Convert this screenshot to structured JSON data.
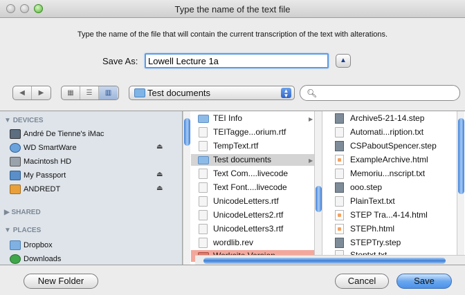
{
  "window": {
    "title": "Type the name of the text file"
  },
  "message": "Type the name of the file that will contain the current transcription of the text with alterations.",
  "save_as": {
    "label": "Save As:",
    "value": "Lowell Lecture 1a"
  },
  "toolbar": {
    "path": "Test documents",
    "search_placeholder": "",
    "nav_back_icon": "back-arrow-icon",
    "nav_forward_icon": "forward-arrow-icon",
    "view_modes": [
      "icon-view",
      "list-view",
      "column-view"
    ],
    "active_view": "column-view"
  },
  "sidebar": {
    "devices_heading": "DEVICES",
    "devices": [
      {
        "label": "André De Tienne's iMac",
        "icon": "imac-icon",
        "eject": false
      },
      {
        "label": "WD SmartWare",
        "icon": "disk-icon",
        "eject": true
      },
      {
        "label": "Macintosh HD",
        "icon": "harddrive-icon",
        "eject": false
      },
      {
        "label": "My Passport",
        "icon": "external-drive-icon",
        "eject": true
      },
      {
        "label": "ANDREDT",
        "icon": "drive-icon",
        "eject": true
      }
    ],
    "shared_heading": "SHARED",
    "places_heading": "PLACES",
    "places": [
      {
        "label": "Dropbox",
        "icon": "dropbox-icon"
      },
      {
        "label": "Downloads",
        "icon": "downloads-icon"
      }
    ]
  },
  "column1": [
    {
      "label": "TEI Info",
      "kind": "folder",
      "has_arrow": true
    },
    {
      "label": "TEITagge...orium.rtf",
      "kind": "doc"
    },
    {
      "label": "TempText.rtf",
      "kind": "doc"
    },
    {
      "label": "Test documents",
      "kind": "folder",
      "has_arrow": true,
      "selected": true
    },
    {
      "label": "Text Com....livecode",
      "kind": "doc"
    },
    {
      "label": "Text Font....livecode",
      "kind": "doc"
    },
    {
      "label": "UnicodeLetters.rtf",
      "kind": "doc"
    },
    {
      "label": "UnicodeLetters2.rtf",
      "kind": "doc"
    },
    {
      "label": "UnicodeLetters3.rtf",
      "kind": "doc"
    },
    {
      "label": "wordlib.rev",
      "kind": "doc"
    },
    {
      "label": "Worksite Version",
      "kind": "folder-red"
    }
  ],
  "column2": [
    {
      "label": "Archive5-21-14.step",
      "kind": "stack"
    },
    {
      "label": "Automati...ription.txt",
      "kind": "doc"
    },
    {
      "label": "CSPaboutSpencer.step",
      "kind": "stack"
    },
    {
      "label": "ExampleArchive.html",
      "kind": "html"
    },
    {
      "label": "Memoriu...nscript.txt",
      "kind": "doc"
    },
    {
      "label": "ooo.step",
      "kind": "stack"
    },
    {
      "label": "PlainText.txt",
      "kind": "doc"
    },
    {
      "label": "STEP Tra...4-14.html",
      "kind": "html"
    },
    {
      "label": "STEPh.html",
      "kind": "html"
    },
    {
      "label": "STEPTry.step",
      "kind": "stack"
    },
    {
      "label": "Steptxt.txt",
      "kind": "doc"
    }
  ],
  "buttons": {
    "new_folder": "New Folder",
    "cancel": "Cancel",
    "save": "Save"
  }
}
